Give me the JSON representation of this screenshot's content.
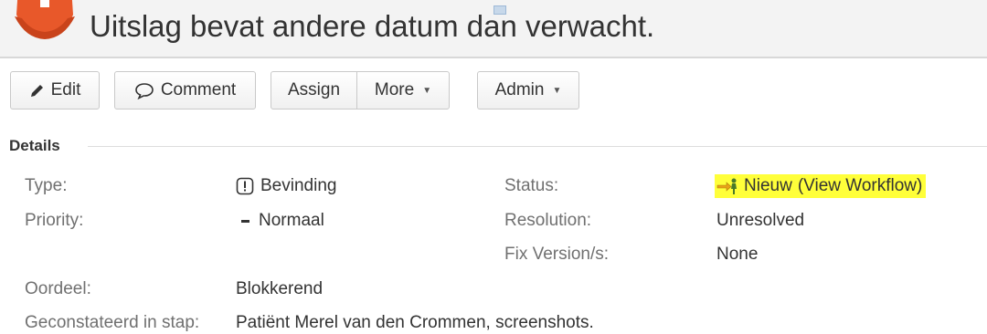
{
  "issue": {
    "title": "Uitslag bevat andere datum dan verwacht."
  },
  "toolbar": {
    "edit_label": "Edit",
    "comment_label": "Comment",
    "assign_label": "Assign",
    "more_label": "More",
    "admin_label": "Admin"
  },
  "details": {
    "section_title": "Details",
    "type_label": "Type:",
    "type_value": "Bevinding",
    "priority_label": "Priority:",
    "priority_value": "Normaal",
    "status_label": "Status:",
    "status_value": "Nieuw",
    "status_link": "(View Workflow)",
    "resolution_label": "Resolution:",
    "resolution_value": "Unresolved",
    "fix_version_label": "Fix Version/s:",
    "fix_version_value": "None",
    "oordeel_label": "Oordeel:",
    "oordeel_value": "Blokkerend",
    "stap_label": "Geconstateerd in stap:",
    "stap_value": "Patiënt Merel van den Crommen, screenshots."
  },
  "colors": {
    "project_icon": "#e8582a",
    "status_highlight": "#ffff3a",
    "status_icon": "#e8a317",
    "label_text": "#707070",
    "value_text": "#333333"
  },
  "icons": {
    "project": "project-avatar-icon",
    "edit": "pencil-icon",
    "comment": "speech-bubble-icon",
    "type": "exclamation-box-icon",
    "priority": "dash-icon",
    "status": "arrow-person-icon"
  }
}
